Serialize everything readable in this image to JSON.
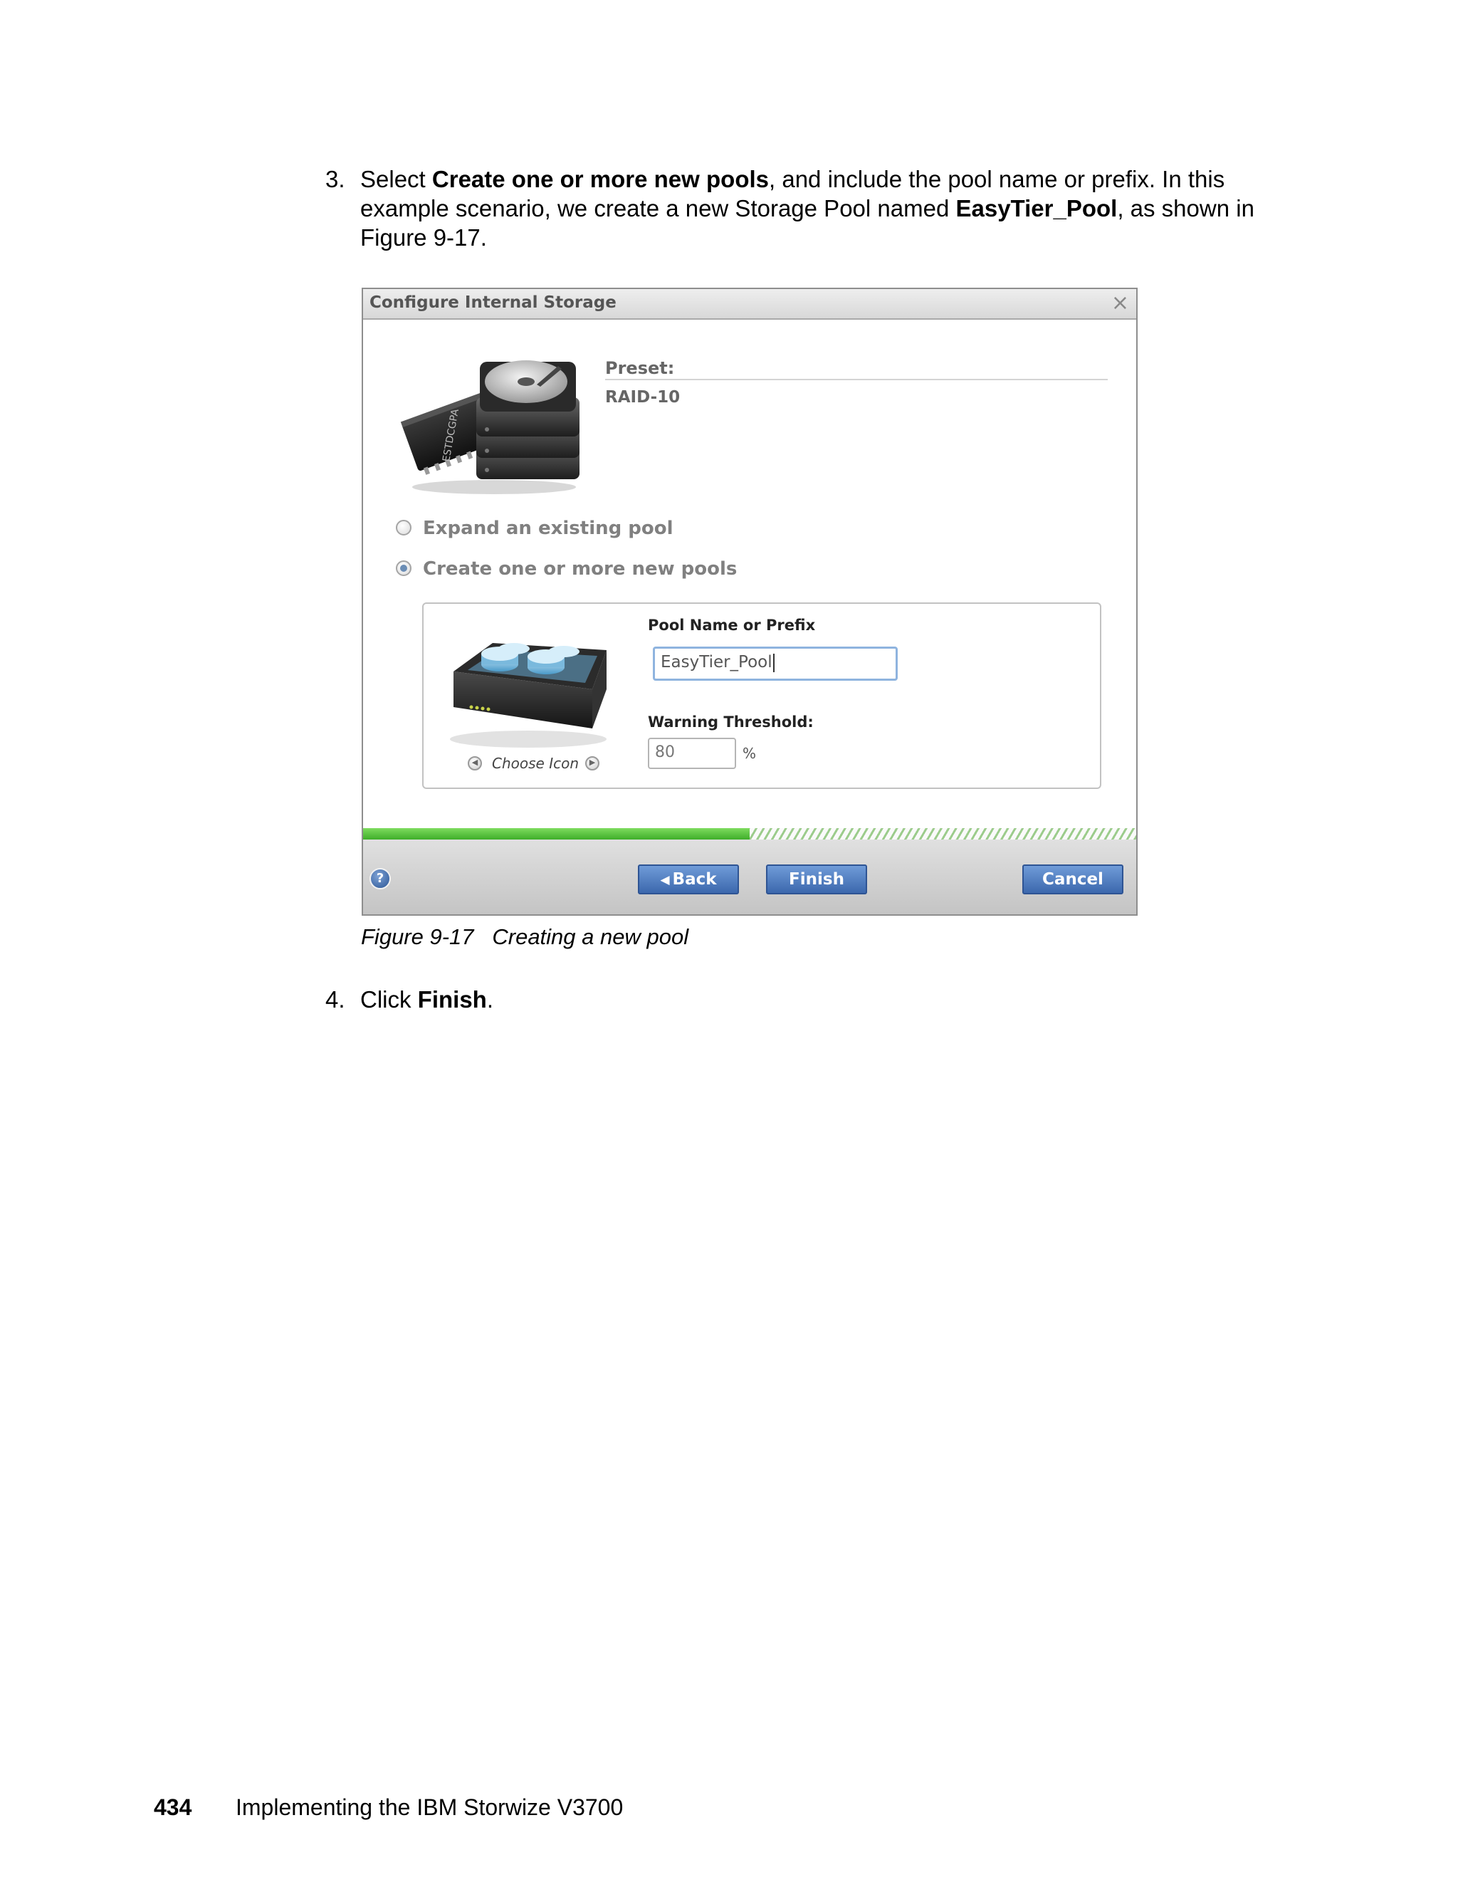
{
  "step3": {
    "number": "3.",
    "text_1": "Select ",
    "bold_1": "Create one or more new pools",
    "text_2": ", and include the pool name or prefix. In this example scenario, we create a new Storage Pool named ",
    "bold_2": "EasyTier_Pool",
    "text_3": ", as shown in Figure 9-17."
  },
  "dialog": {
    "title": "Configure Internal Storage",
    "close_glyph": "×",
    "drive_chip_text": "ESTDCGPA",
    "preset_label": "Preset:",
    "preset_value": "RAID-10",
    "options": {
      "expand": "Expand an existing pool",
      "create": "Create one or more new pools",
      "selected": "create"
    },
    "pool_name_label": "Pool Name or Prefix",
    "pool_name_value": "EasyTier_Pool",
    "threshold_label": "Warning Threshold:",
    "threshold_value": "80",
    "threshold_unit": "%",
    "choose_icon_label": "Choose Icon",
    "progress_fraction": 0.5,
    "help_glyph": "?",
    "buttons": {
      "back": "Back",
      "finish": "Finish",
      "cancel": "Cancel"
    },
    "icons": [
      "storage-drives-icon",
      "storage-pool-icon",
      "close-icon",
      "help-icon",
      "left-arrow-icon",
      "right-arrow-icon"
    ]
  },
  "caption": "Figure 9-17   Creating a new pool",
  "step4": {
    "number": "4.",
    "text_1": "Click ",
    "bold_1": "Finish",
    "text_2": "."
  },
  "footer": {
    "page_number": "434",
    "book_title": "Implementing the IBM Storwize V3700"
  }
}
